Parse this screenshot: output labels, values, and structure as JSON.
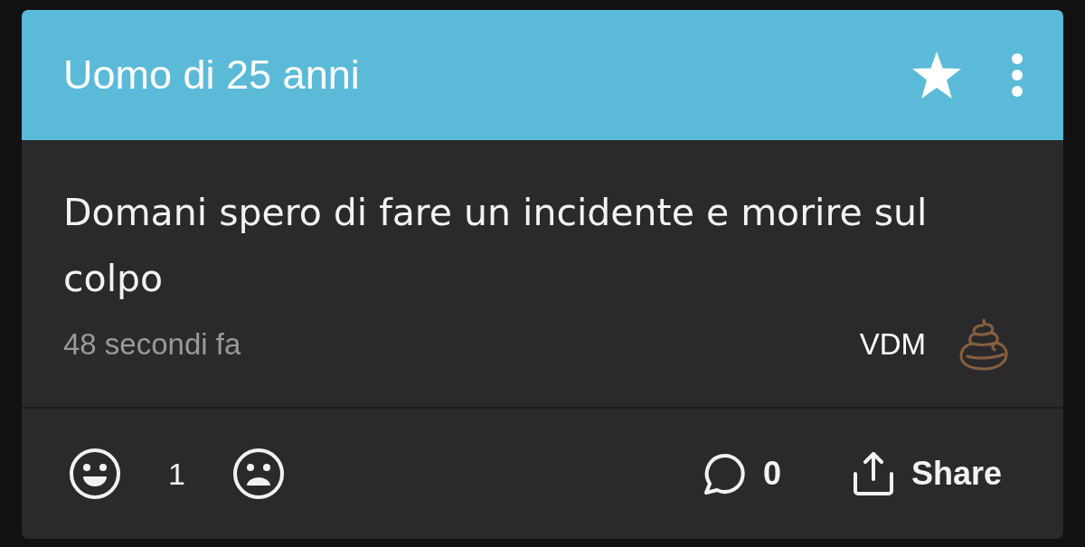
{
  "post": {
    "header": {
      "title": "Uomo di 25 anni"
    },
    "body": {
      "text": "Domani spero di fare un incidente e morire sul colpo",
      "time": "48 secondi fa",
      "tag": "VDM"
    },
    "footer": {
      "likes": "1",
      "comments": "0",
      "share": "Share"
    }
  }
}
